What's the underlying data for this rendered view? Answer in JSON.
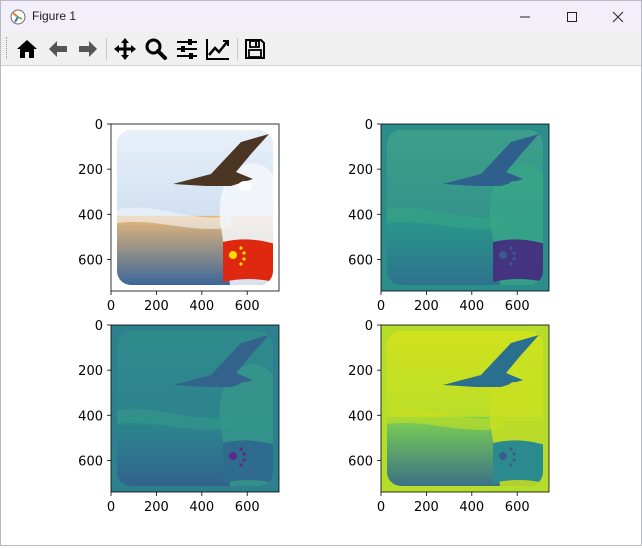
{
  "window": {
    "title": "Figure 1",
    "controls": {
      "minimize": "minimize",
      "maximize": "maximize",
      "close": "close"
    }
  },
  "toolbar": {
    "buttons": [
      {
        "name": "home-button",
        "icon": "home-icon",
        "tooltip": "Reset original view"
      },
      {
        "name": "back-button",
        "icon": "arrow-left-icon",
        "tooltip": "Back to previous view"
      },
      {
        "name": "forward-button",
        "icon": "arrow-right-icon",
        "tooltip": "Forward to next view"
      },
      {
        "name": "pan-button",
        "icon": "move-arrows-icon",
        "tooltip": "Pan axes"
      },
      {
        "name": "zoom-button",
        "icon": "magnifier-icon",
        "tooltip": "Zoom to rectangle"
      },
      {
        "name": "subplots-button",
        "icon": "sliders-icon",
        "tooltip": "Configure subplots"
      },
      {
        "name": "edit-axes-button",
        "icon": "line-chart-icon",
        "tooltip": "Edit axis"
      },
      {
        "name": "save-button",
        "icon": "floppy-disk-icon",
        "tooltip": "Save the figure"
      }
    ]
  },
  "axes_ticks": {
    "x": [
      "0",
      "200",
      "400",
      "600"
    ],
    "y": [
      "0",
      "200",
      "400",
      "600"
    ]
  },
  "subplots": [
    {
      "name": "subplot-original",
      "content": "Eagle flying over sea wave with Chinese flag, full color"
    },
    {
      "name": "subplot-channel-1",
      "content": "Single channel shown with viridis colormap"
    },
    {
      "name": "subplot-channel-2",
      "content": "Single channel shown with viridis colormap, darker"
    },
    {
      "name": "subplot-channel-3",
      "content": "Single channel shown with viridis colormap, bright yellow-green"
    }
  ],
  "colors": {
    "titlebar": "#f3eff9",
    "toolbar": "#f0f0f0",
    "viridis_dark": "#440154",
    "viridis_mid": "#21918c",
    "viridis_light": "#fde725",
    "flag_red": "#de2910",
    "flag_yellow": "#ffde00"
  }
}
